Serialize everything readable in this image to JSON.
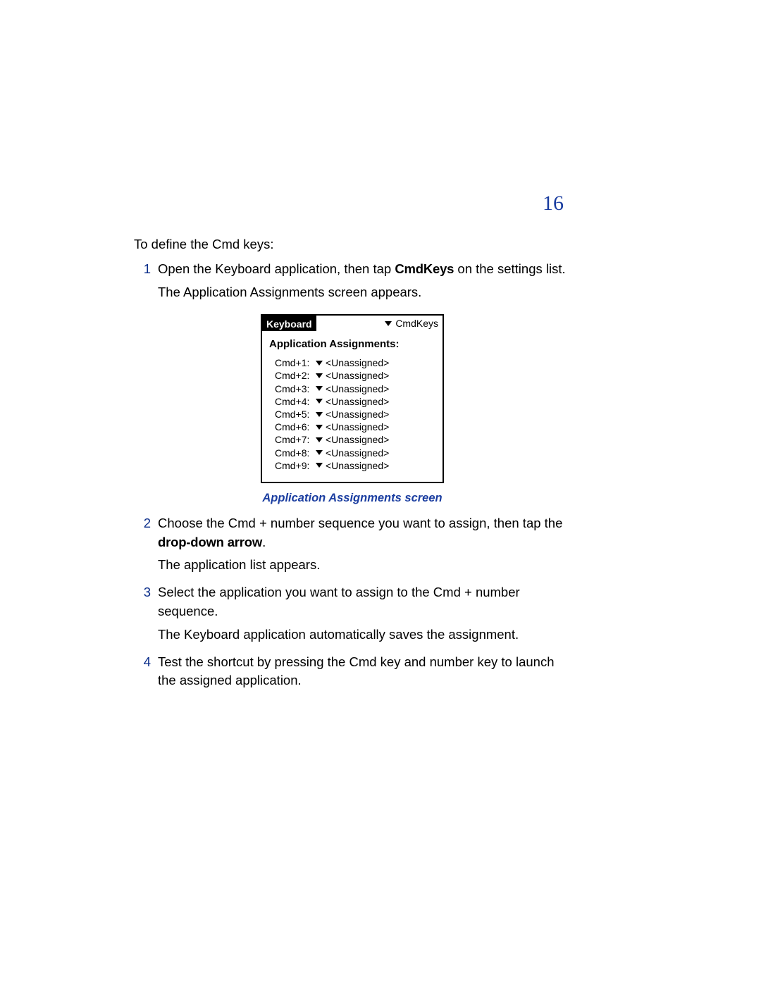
{
  "page_number": "16",
  "intro": "To define the Cmd keys:",
  "steps": [
    {
      "num": "1",
      "line1_pre": "Open the Keyboard application, then tap ",
      "line1_bold": "CmdKeys",
      "line1_post": " on the settings list.",
      "line2": "The Application Assignments screen appears."
    },
    {
      "num": "2",
      "line1_pre": "Choose the Cmd + number sequence you want to assign, then tap the ",
      "line1_bold": "drop-down arrow",
      "line1_post": ".",
      "line2": "The application list appears."
    },
    {
      "num": "3",
      "line1": "Select the application you want to assign to the Cmd + number sequence.",
      "line2": "The Keyboard application automatically saves the assignment."
    },
    {
      "num": "4",
      "line1": "Test the shortcut by pressing the Cmd key and number key to launch the assigned application."
    }
  ],
  "palm": {
    "title": "Keyboard",
    "menu": "CmdKeys",
    "heading": "Application Assignments:",
    "rows": [
      {
        "label": "Cmd+1:",
        "value": "<Unassigned>"
      },
      {
        "label": "Cmd+2:",
        "value": "<Unassigned>"
      },
      {
        "label": "Cmd+3:",
        "value": "<Unassigned>"
      },
      {
        "label": "Cmd+4:",
        "value": "<Unassigned>"
      },
      {
        "label": "Cmd+5:",
        "value": "<Unassigned>"
      },
      {
        "label": "Cmd+6:",
        "value": "<Unassigned>"
      },
      {
        "label": "Cmd+7:",
        "value": "<Unassigned>"
      },
      {
        "label": "Cmd+8:",
        "value": "<Unassigned>"
      },
      {
        "label": "Cmd+9:",
        "value": "<Unassigned>"
      }
    ],
    "caption": "Application Assignments screen"
  }
}
